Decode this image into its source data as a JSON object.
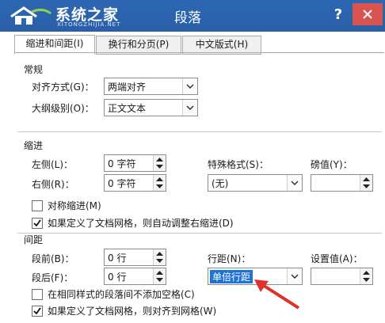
{
  "watermark": {
    "title": "系统之家",
    "subtitle": "XITONGZHIJIA.NET"
  },
  "window": {
    "title": "段落",
    "help": "?"
  },
  "tabs": [
    {
      "label": "缩进和间距(I)"
    },
    {
      "label": "换行和分页(P)"
    },
    {
      "label": "中文版式(H)"
    }
  ],
  "general": {
    "heading": "常规",
    "alignment_label": "对齐方式(G)：",
    "alignment_value": "两端对齐",
    "outline_label": "大纲级别(O)：",
    "outline_value": "正文文本"
  },
  "indent": {
    "heading": "缩进",
    "left_label": "左侧(L)：",
    "left_value": "0 字符",
    "right_label": "右侧(R)：",
    "right_value": "0 字符",
    "special_label": "特殊格式(S)：",
    "special_value": "(无)",
    "by_label": "磅值(Y)：",
    "by_value": "",
    "mirror_label": "对称缩进(M)",
    "mirror_checked": false,
    "grid_label": "如果定义了文档网格，则自动调整右缩进(D)",
    "grid_checked": true
  },
  "spacing": {
    "heading": "间距",
    "before_label": "段前(B)：",
    "before_value": "0 行",
    "after_label": "段后(F)：",
    "after_value": "0 行",
    "line_label": "行距(N)：",
    "line_value": "单倍行距",
    "at_label": "设置值(A)：",
    "at_value": "",
    "no_space_label": "在相同样式的段落间不添加空格(C)",
    "no_space_checked": false,
    "snap_label": "如果定义了文档网格，则对齐到网格(W)",
    "snap_checked": true
  },
  "colors": {
    "titlebar": "#2c67b3",
    "close": "#d9534f",
    "selection": "#1e73d8",
    "annotation": "#e0302a"
  }
}
